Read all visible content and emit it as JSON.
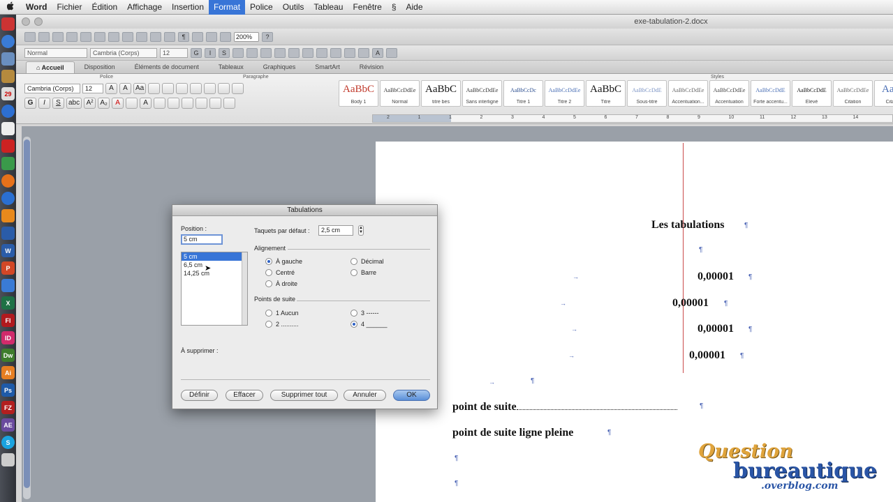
{
  "menubar": {
    "apple": "",
    "items": [
      "Word",
      "Fichier",
      "Édition",
      "Affichage",
      "Insertion",
      "Format",
      "Police",
      "Outils",
      "Tableau",
      "Fenêtre",
      "Aide"
    ],
    "script_icon": "§"
  },
  "window": {
    "title": "exe-tabulation-2.docx",
    "zoom": "200%",
    "style_field": "Normal",
    "font_field": "Cambria (Corps)",
    "size_field": "12"
  },
  "ribbon": {
    "tabs": [
      "Accueil",
      "Disposition",
      "Éléments de document",
      "Tableaux",
      "Graphiques",
      "SmartArt",
      "Révision"
    ],
    "groups": {
      "police": "Police",
      "paragraphe": "Paragraphe",
      "styles": "Styles"
    },
    "font": "Cambria (Corps)",
    "size": "12",
    "styles": [
      {
        "sample": "AaBbC",
        "name": "Body 1",
        "color": "#c0392b"
      },
      {
        "sample": "AaBbCcDdEe",
        "name": "Normal",
        "color": "#333333"
      },
      {
        "sample": "AaBbC",
        "name": "titre bes",
        "color": "#111111"
      },
      {
        "sample": "AaBbCcDdEe",
        "name": "Sans interligne",
        "color": "#333333"
      },
      {
        "sample": "AaBbCcDc",
        "name": "Titre 1",
        "color": "#2a4d8f"
      },
      {
        "sample": "AaBbCcDdEe",
        "name": "Titre 2",
        "color": "#4a6fb5"
      },
      {
        "sample": "AaBbC",
        "name": "Titre",
        "color": "#111111"
      },
      {
        "sample": "AaBbCcDdE",
        "name": "Sous-titre",
        "color": "#7b93c4"
      },
      {
        "sample": "AaBbCcDdEe",
        "name": "Accentuation...",
        "color": "#666666"
      },
      {
        "sample": "AaBbCcDdEe",
        "name": "Accentuation",
        "color": "#444444"
      },
      {
        "sample": "AaBbCcDdE",
        "name": "Forte accentu...",
        "color": "#4a6fb5"
      },
      {
        "sample": "AaBbCcDdE",
        "name": "Élevé",
        "color": "#111111"
      },
      {
        "sample": "AaBbCcDdEe",
        "name": "Citation",
        "color": "#666666"
      },
      {
        "sample": "AaBb",
        "name": "Citation",
        "color": "#4a6fb5"
      }
    ]
  },
  "ruler": {
    "numbers": [
      "2",
      "1",
      "1",
      "2",
      "3",
      "4",
      "5",
      "6",
      "7",
      "8",
      "9",
      "10",
      "11",
      "12",
      "13",
      "14"
    ]
  },
  "document": {
    "heading": "Les tabulations",
    "values": [
      "0,00001",
      "0,00001",
      "0,00001",
      "0,00001"
    ],
    "line_dots_label": "point de suite",
    "line_full_label": "point de suite ligne pleine",
    "pilcrow": "¶",
    "tab_arrow": "→"
  },
  "dialog": {
    "title": "Tabulations",
    "position_label": "Position :",
    "position_value": "5 cm",
    "positions": [
      "5 cm",
      "6,5 cm",
      "14,25 cm"
    ],
    "default_label": "Taquets par défaut :",
    "default_value": "2,5 cm",
    "alignment_label": "Alignement",
    "alignment": {
      "left": "À gauche",
      "center": "Centré",
      "right": "À droite",
      "decimal": "Décimal",
      "bar": "Barre"
    },
    "leader_label": "Points de suite",
    "leaders": {
      "none": "1 Aucun",
      "dots": "2 ..........",
      "dashes": "3 ------",
      "line": "4 ______"
    },
    "delete_label": "À supprimer :",
    "buttons": {
      "define": "Définir",
      "clear": "Effacer",
      "clear_all": "Supprimer tout",
      "cancel": "Annuler",
      "ok": "OK"
    }
  },
  "watermark": {
    "line1": "Question",
    "line2": "bureautique",
    "line3": ".overblog.com"
  },
  "colors": {
    "accent": "#3875d7",
    "margin_line": "#c94b4b",
    "pilcrow": "#4a63b5"
  }
}
